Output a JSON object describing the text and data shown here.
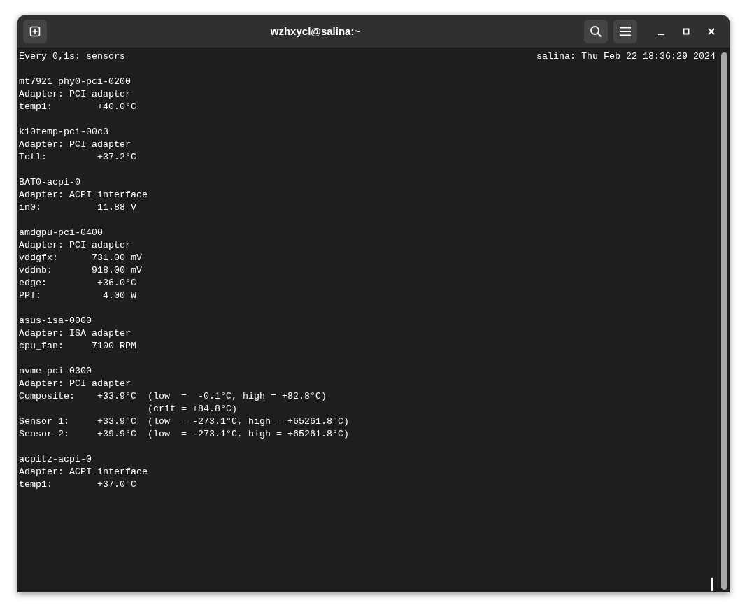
{
  "window": {
    "title": "wzhxycl@salina:~"
  },
  "terminal": {
    "header_left": "Every 0,1s: sensors",
    "header_right": "salina: Thu Feb 22 18:36:29 2024",
    "blocks": [
      {
        "lines": [
          "mt7921_phy0-pci-0200",
          "Adapter: PCI adapter",
          "temp1:        +40.0°C"
        ]
      },
      {
        "lines": [
          "k10temp-pci-00c3",
          "Adapter: PCI adapter",
          "Tctl:         +37.2°C"
        ]
      },
      {
        "lines": [
          "BAT0-acpi-0",
          "Adapter: ACPI interface",
          "in0:          11.88 V"
        ]
      },
      {
        "lines": [
          "amdgpu-pci-0400",
          "Adapter: PCI adapter",
          "vddgfx:      731.00 mV",
          "vddnb:       918.00 mV",
          "edge:         +36.0°C",
          "PPT:           4.00 W"
        ]
      },
      {
        "lines": [
          "asus-isa-0000",
          "Adapter: ISA adapter",
          "cpu_fan:     7100 RPM"
        ]
      },
      {
        "lines": [
          "nvme-pci-0300",
          "Adapter: PCI adapter",
          "Composite:    +33.9°C  (low  =  -0.1°C, high = +82.8°C)",
          "                       (crit = +84.8°C)",
          "Sensor 1:     +33.9°C  (low  = -273.1°C, high = +65261.8°C)",
          "Sensor 2:     +39.9°C  (low  = -273.1°C, high = +65261.8°C)"
        ]
      },
      {
        "lines": [
          "acpitz-acpi-0",
          "Adapter: ACPI interface",
          "temp1:        +37.0°C"
        ]
      }
    ]
  }
}
